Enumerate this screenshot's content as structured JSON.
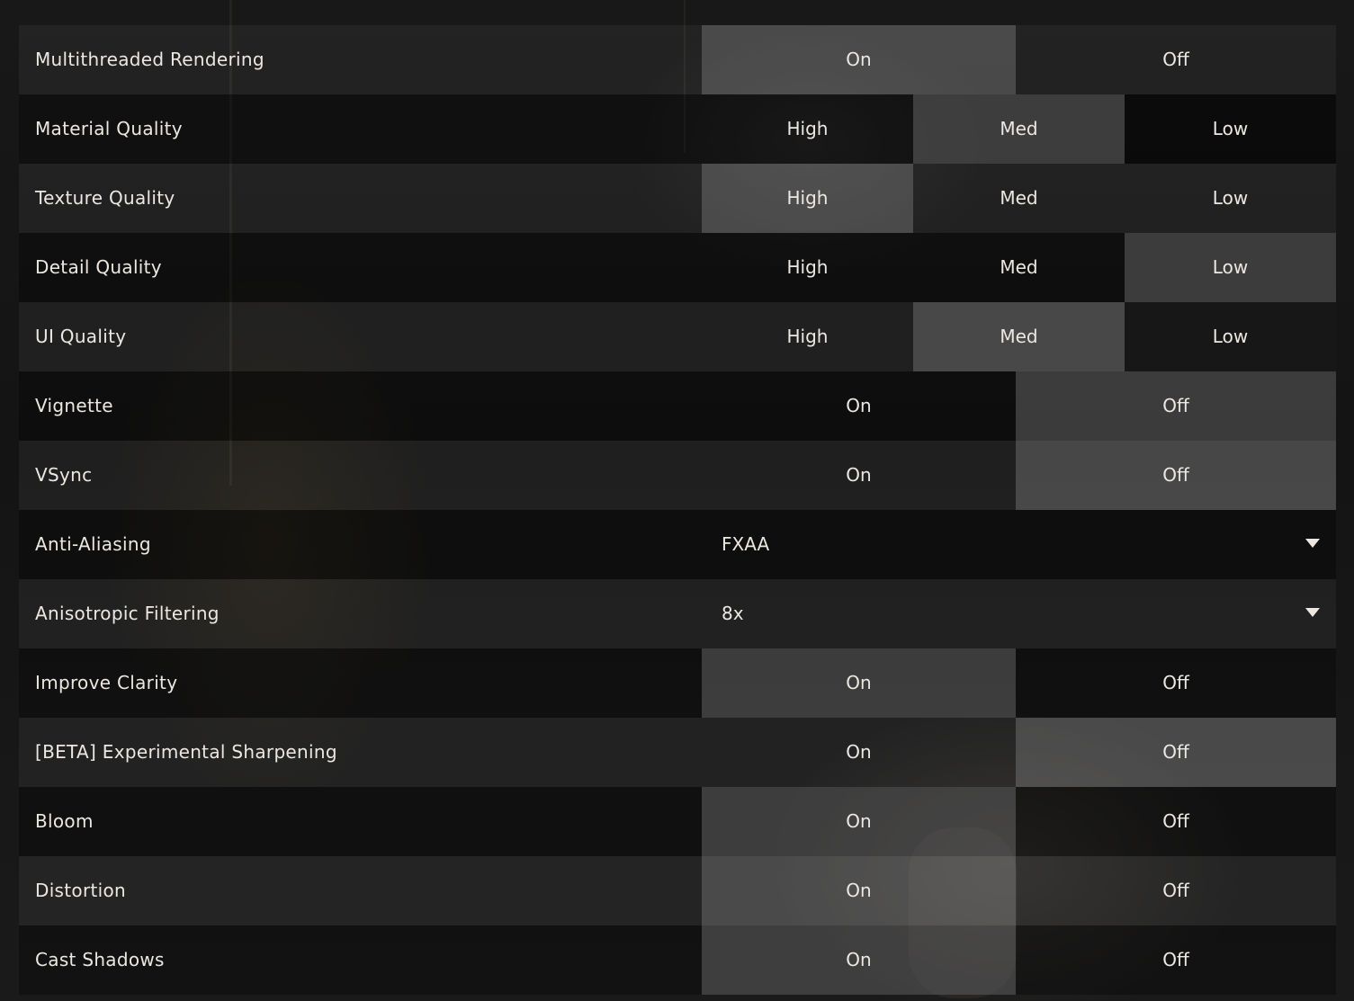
{
  "settings": [
    {
      "label": "Multithreaded Rendering",
      "type": "toggle",
      "options": [
        "On",
        "Off"
      ],
      "selected": "On"
    },
    {
      "label": "Material Quality",
      "type": "quality",
      "options": [
        "High",
        "Med",
        "Low"
      ],
      "selected": "Med"
    },
    {
      "label": "Texture Quality",
      "type": "quality",
      "options": [
        "High",
        "Med",
        "Low"
      ],
      "selected": "High"
    },
    {
      "label": "Detail Quality",
      "type": "quality",
      "options": [
        "High",
        "Med",
        "Low"
      ],
      "selected": "Low"
    },
    {
      "label": "UI Quality",
      "type": "quality",
      "options": [
        "High",
        "Med",
        "Low"
      ],
      "selected": "Med"
    },
    {
      "label": "Vignette",
      "type": "toggle",
      "options": [
        "On",
        "Off"
      ],
      "selected": "Off"
    },
    {
      "label": "VSync",
      "type": "toggle",
      "options": [
        "On",
        "Off"
      ],
      "selected": "Off"
    },
    {
      "label": "Anti-Aliasing",
      "type": "dropdown",
      "value": "FXAA"
    },
    {
      "label": "Anisotropic Filtering",
      "type": "dropdown",
      "value": "8x"
    },
    {
      "label": "Improve Clarity",
      "type": "toggle",
      "options": [
        "On",
        "Off"
      ],
      "selected": "On"
    },
    {
      "label": "[BETA] Experimental Sharpening",
      "type": "toggle",
      "options": [
        "On",
        "Off"
      ],
      "selected": "Off"
    },
    {
      "label": "Bloom",
      "type": "toggle",
      "options": [
        "On",
        "Off"
      ],
      "selected": "On"
    },
    {
      "label": "Distortion",
      "type": "toggle",
      "options": [
        "On",
        "Off"
      ],
      "selected": "On"
    },
    {
      "label": "Cast Shadows",
      "type": "toggle",
      "options": [
        "On",
        "Off"
      ],
      "selected": "On"
    }
  ],
  "icons": {
    "dropdown": "chevron-down-icon"
  },
  "colors": {
    "text": "#ece8e1",
    "selected_fill": "#5a5a5a"
  }
}
